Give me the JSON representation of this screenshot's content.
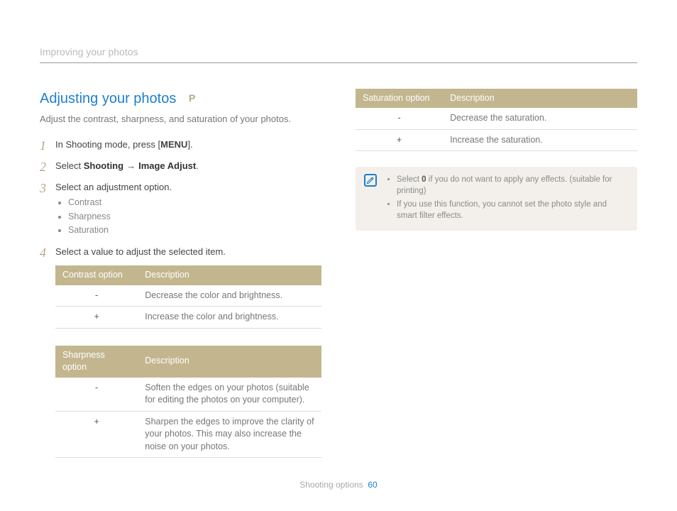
{
  "header": {
    "breadcrumb": "Improving your photos"
  },
  "heading": {
    "title": "Adjusting your photos",
    "mode": "P"
  },
  "intro": "Adjust the contrast, sharpness, and saturation of your photos.",
  "steps": {
    "s1_pre": "In Shooting mode, press [",
    "s1_menu": "MENU",
    "s1_post": "].",
    "s2_pre": "Select ",
    "s2_b1": "Shooting",
    "s2_arrow": "→",
    "s2_b2": "Image Adjust",
    "s2_post": ".",
    "s3": "Select an adjustment option.",
    "s3_opts": [
      "Contrast",
      "Sharpness",
      "Saturation"
    ],
    "s4": "Select a value to adjust the selected item."
  },
  "tables": {
    "contrast": {
      "h1": "Contrast option",
      "h2": "Description",
      "rows": [
        {
          "opt": "-",
          "desc": "Decrease the color and brightness."
        },
        {
          "opt": "+",
          "desc": "Increase the color and brightness."
        }
      ]
    },
    "sharpness": {
      "h1": "Sharpness option",
      "h2": "Description",
      "rows": [
        {
          "opt": "-",
          "desc": "Soften the edges on your photos (suitable for editing the photos on your computer)."
        },
        {
          "opt": "+",
          "desc": "Sharpen the edges to improve the clarity of your photos. This may also increase the noise on your photos."
        }
      ]
    },
    "saturation": {
      "h1": "Saturation option",
      "h2": "Description",
      "rows": [
        {
          "opt": "-",
          "desc": "Decrease the saturation."
        },
        {
          "opt": "+",
          "desc": "Increase the saturation."
        }
      ]
    }
  },
  "notes": {
    "n1_pre": "Select ",
    "n1_bold": "0",
    "n1_post": " if you do not want to apply any effects. (suitable for printing)",
    "n2": "If you use this function, you cannot set the photo style and smart filter effects."
  },
  "footer": {
    "section": "Shooting options",
    "page": "60"
  }
}
